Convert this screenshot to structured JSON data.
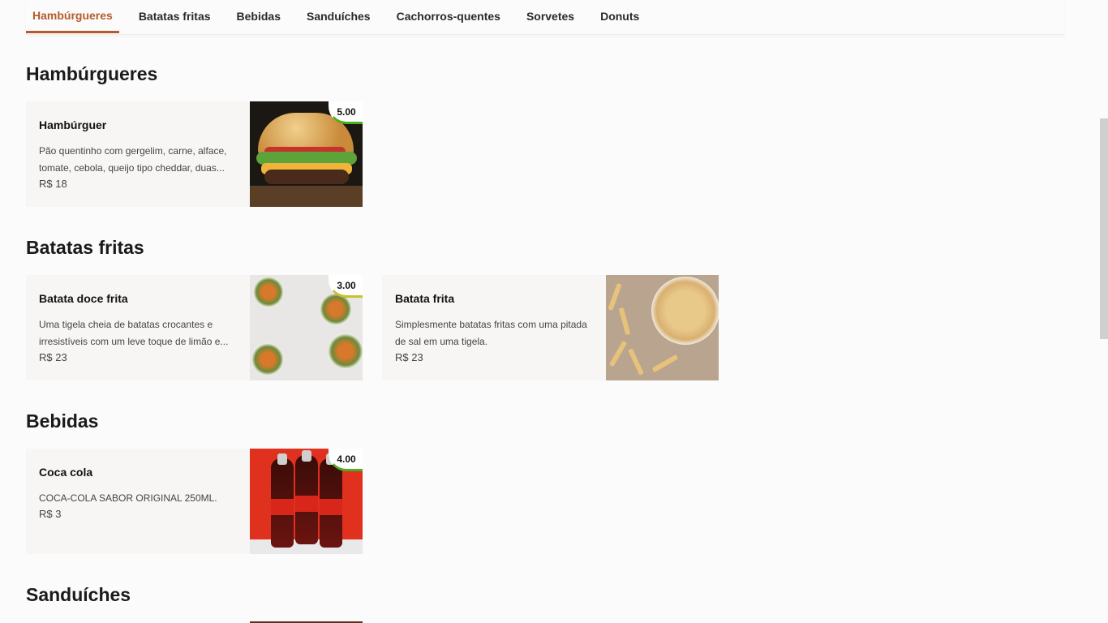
{
  "tabs": [
    "Hambúrgueres",
    "Batatas fritas",
    "Bebidas",
    "Sanduíches",
    "Cachorros-quentes",
    "Sorvetes",
    "Donuts"
  ],
  "active_tab": "Hambúrgueres",
  "colors": {
    "accent": "#b55a2a",
    "rating_green": "#4caf1f",
    "rating_yellow": "#c9c02a",
    "card_bg": "#f8f6f5"
  },
  "sections": [
    {
      "title": "Hambúrgueres",
      "items": [
        {
          "name": "Hambúrguer",
          "description": "Pão quentinho com gergelim, carne, alface, tomate, cebola, queijo tipo cheddar, duas...",
          "price": "R$ 18",
          "rating": "5.00",
          "image": "burger-photo"
        }
      ]
    },
    {
      "title": "Batatas fritas",
      "items": [
        {
          "name": "Batata doce frita",
          "description": "Uma tigela cheia de batatas crocantes e irresistíveis com um leve toque de limão e...",
          "price": "R$ 23",
          "rating": "3.00",
          "image": "fries-bowls-photo"
        },
        {
          "name": "Batata frita",
          "description": "Simplesmente batatas fritas com uma pitada de sal em uma tigela.",
          "price": "R$ 23",
          "image": "fries-plate-photo"
        }
      ]
    },
    {
      "title": "Bebidas",
      "items": [
        {
          "name": "Coca cola",
          "description": "COCA-COLA SABOR ORIGINAL 250ML.",
          "price": "R$ 3",
          "rating": "4.00",
          "image": "coke-bottles-photo"
        }
      ]
    },
    {
      "title": "Sanduíches",
      "items": []
    }
  ]
}
